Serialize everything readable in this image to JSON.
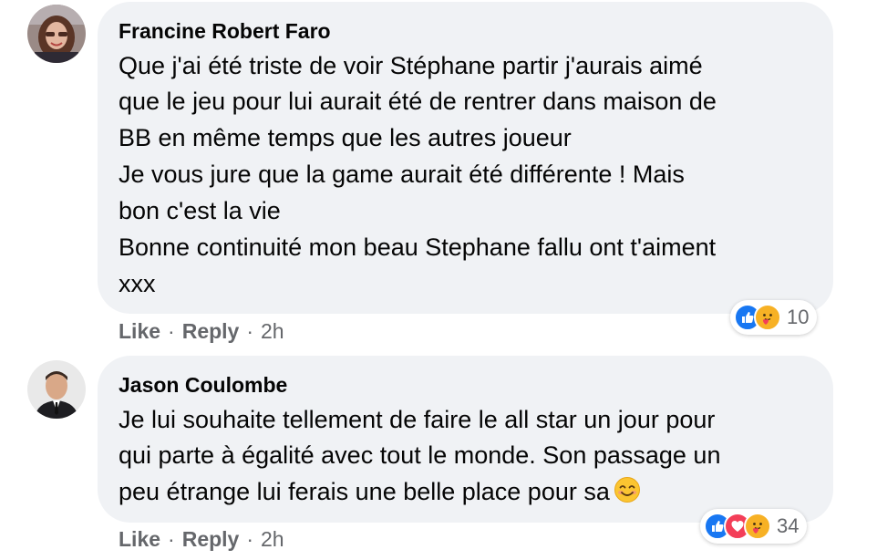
{
  "comments": [
    {
      "author": "Francine Robert Faro",
      "lines": [
        "Que j'ai été triste de voir Stéphane partir j'aurais aimé",
        "que le jeu pour lui aurait été de rentrer dans maison de",
        "BB en même temps que les autres joueur",
        "Je vous jure que la game aurait été différente ! Mais",
        "bon c'est la vie",
        "Bonne continuité mon beau Stephane fallu ont t'aiment",
        "xxx"
      ],
      "actions": {
        "like": "Like",
        "reply": "Reply",
        "time": "2h"
      },
      "reactions": {
        "icons": [
          "like-icon",
          "care-icon"
        ],
        "count": "10"
      }
    },
    {
      "author": "Jason Coulombe",
      "lines": [
        "Je lui souhaite tellement de faire le all star un jour pour",
        "qui parte à égalité avec tout le monde. Son passage un",
        "peu étrange lui ferais une belle place pour sa"
      ],
      "actions": {
        "like": "Like",
        "reply": "Reply",
        "time": "2h"
      },
      "reactions": {
        "icons": [
          "like-icon",
          "love-icon",
          "care-icon"
        ],
        "count": "34"
      }
    }
  ],
  "separator": "·",
  "colors": {
    "bubble": "#f0f2f5",
    "secondary_text": "#65676b",
    "like_blue": "#1877f2",
    "love_red": "#f33e58",
    "care_yellow": "#f7b125"
  }
}
